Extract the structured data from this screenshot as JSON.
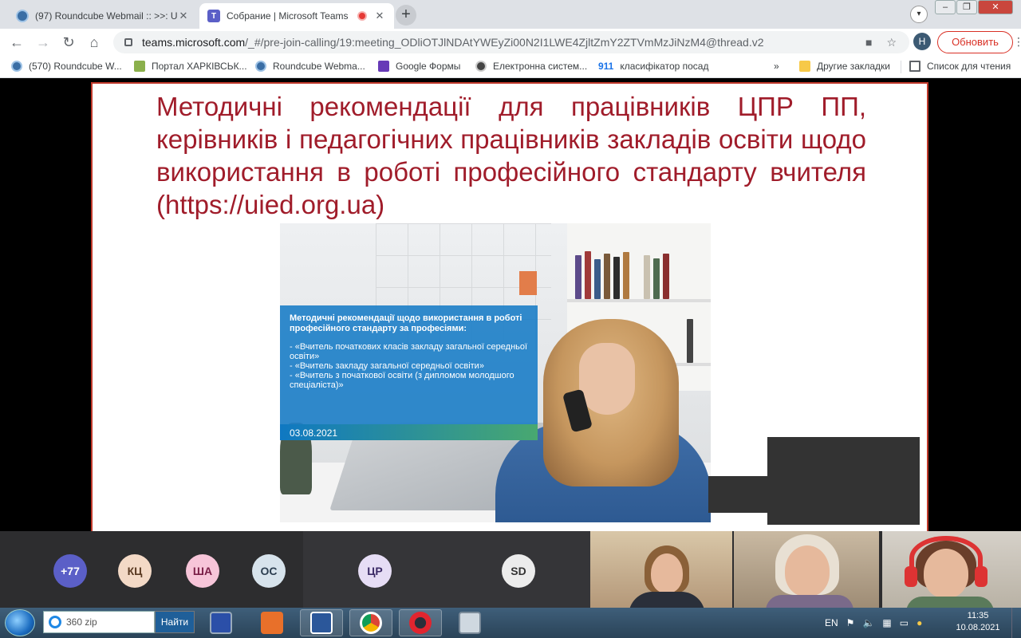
{
  "browser": {
    "tabs": [
      {
        "title": "(97) Roundcube Webmail :: >>: U",
        "active": false
      },
      {
        "title": "Собрание | Microsoft Teams",
        "active": true
      }
    ],
    "new_tab": "+",
    "profile_initial": "H",
    "address": {
      "domain": "teams.microsoft.com",
      "path": "/_#/pre-join-calling/19:meeting_ODliOTJlNDAtYWEyZi00N2I1LWE4ZjltZmY2ZTVmMzJiNzM4@thread.v2"
    },
    "update_button": "Обновить",
    "bookmarks": [
      {
        "label": "(570) Roundcube W...",
        "icon": "roundcube-icon"
      },
      {
        "label": "Портал ХАРКІВСЬК...",
        "icon": "portal-icon"
      },
      {
        "label": "Roundcube Webma...",
        "icon": "roundcube-icon"
      },
      {
        "label": "Google Формы",
        "icon": "forms-icon"
      },
      {
        "label": "Електронна систем...",
        "icon": "globe-icon"
      },
      {
        "label": "класифікатор посад",
        "icon": "code-icon"
      }
    ],
    "bookmarks_more": "»",
    "other_bookmarks": "Другие закладки",
    "reading_list": "Список для чтения"
  },
  "slide": {
    "title": "Методичні рекомендації для працівників ЦПР ПП, керівників і педагогічних працівників закладів освіти щодо використання в роботі професійного стандарту вчителя (https://uied.org.ua)",
    "box_heading": "Методичні рекомендації щодо використання в роботі професійного стандарту за професіями:",
    "box_items": [
      "- «Вчитель початкових класів закладу загальної середньої освіти»",
      "- «Вчитель закладу загальної середньої освіти»",
      "- «Вчитель з початкової освіти (з дипломом молодшого спеціаліста)»"
    ],
    "box_date": "03.08.2021"
  },
  "participants": {
    "circles": [
      {
        "label": "+77",
        "bg": "#5b5fc7",
        "fg": "#ffffff"
      },
      {
        "label": "КЦ",
        "bg": "#f3d9c6",
        "fg": "#5a3a22"
      },
      {
        "label": "ША",
        "bg": "#f7c5d9",
        "fg": "#7a1f47"
      },
      {
        "label": "ОС",
        "bg": "#d7e3ec",
        "fg": "#2c3e50"
      },
      {
        "label": "ЦР",
        "bg": "#e6ddf5",
        "fg": "#3b2a66"
      },
      {
        "label": "SD",
        "bg": "#ececec",
        "fg": "#333333"
      }
    ]
  },
  "taskbar": {
    "search_placeholder": "360 zip",
    "search_button": "Найти",
    "lang": "EN",
    "time": "11:35",
    "date": "10.08.2021"
  },
  "colors": {
    "accent_red": "#a01c2a",
    "teams_purple": "#5b5fc7",
    "slide_border": "#c0392b"
  }
}
